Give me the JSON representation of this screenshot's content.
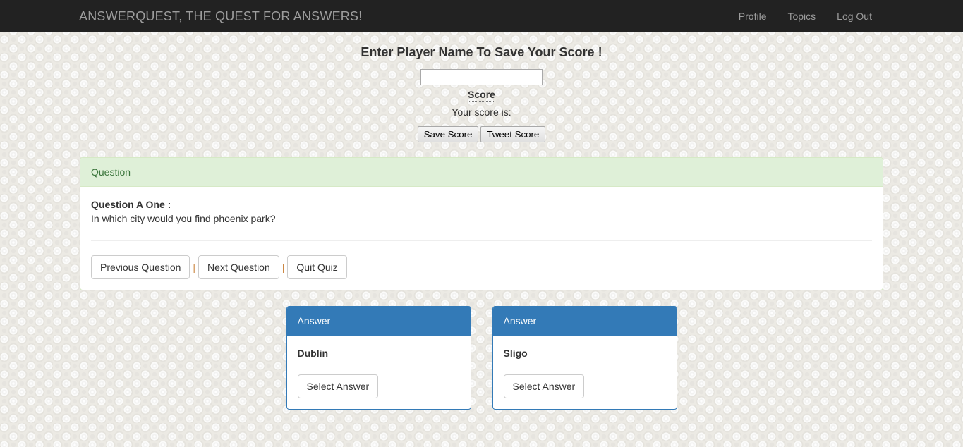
{
  "navbar": {
    "brand": "ANSWERQUEST, THE QUEST FOR ANSWERS!",
    "links": [
      {
        "label": "Profile"
      },
      {
        "label": "Topics"
      },
      {
        "label": "Log Out"
      }
    ]
  },
  "score_section": {
    "title": "Enter Player Name To Save Your Score !",
    "player_name_value": "",
    "player_name_placeholder": "",
    "score_label": "Score",
    "score_value_text": "Your score is:",
    "save_button": "Save Score",
    "tweet_button": "Tweet Score"
  },
  "question_panel": {
    "heading": "Question",
    "title": "Question A One :",
    "text": "In which city would you find phoenix park?",
    "prev_button": "Previous Question",
    "next_button": "Next Question",
    "quit_button": "Quit Quiz",
    "separator": "|"
  },
  "answers": [
    {
      "heading": "Answer",
      "text": "Dublin",
      "button": "Select Answer"
    },
    {
      "heading": "Answer",
      "text": "Sligo",
      "button": "Select Answer"
    }
  ],
  "colors": {
    "navbar_bg": "#222222",
    "navbar_text": "#9d9d9d",
    "panel_success_bg": "#dff0d8",
    "panel_success_border": "#d6e9c6",
    "panel_success_text": "#3c763d",
    "panel_primary": "#337ab7",
    "page_bg": "#eceae4"
  }
}
